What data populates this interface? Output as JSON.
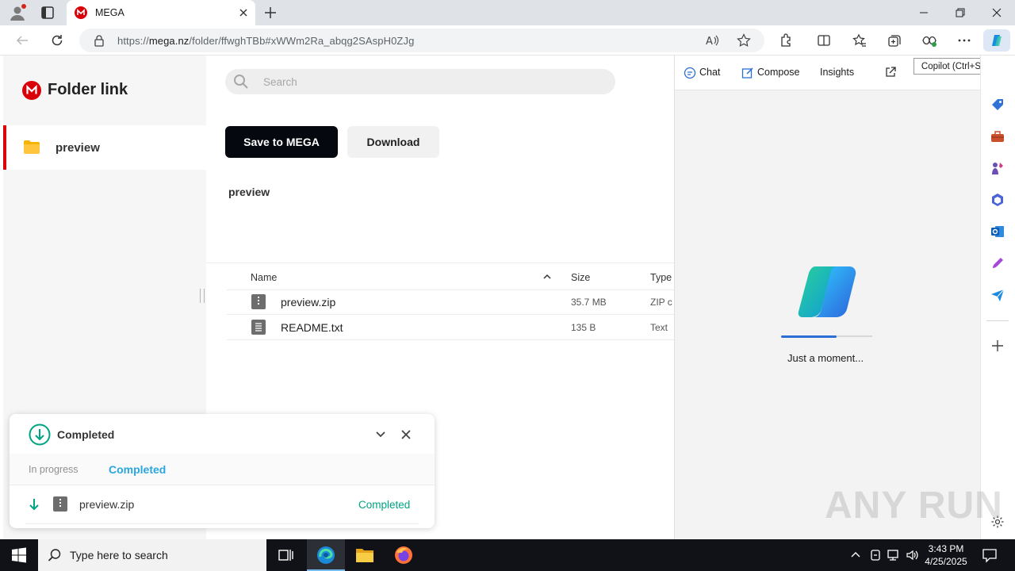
{
  "browser": {
    "tab_title": "MEGA",
    "url_prefix": "https://",
    "url_host": "mega.nz",
    "url_path": "/folder/ffwghTBb#xWWm2Ra_abqg2SAspH0ZJg"
  },
  "mega": {
    "brand": "Folder link",
    "sidebar_item": "preview",
    "search_placeholder": "Search",
    "save_button": "Save to MEGA",
    "download_button": "Download",
    "folder_title": "preview",
    "columns": {
      "name": "Name",
      "size": "Size",
      "type": "Type"
    },
    "files": [
      {
        "name": "preview.zip",
        "size": "35.7 MB",
        "type": "ZIP c"
      },
      {
        "name": "README.txt",
        "size": "135 B",
        "type": "Text"
      }
    ]
  },
  "transfers": {
    "title": "Completed",
    "tab_in_progress": "In progress",
    "tab_completed": "Completed",
    "item_name": "preview.zip",
    "item_status": "Completed"
  },
  "copilot": {
    "tabs": [
      "Chat",
      "Compose",
      "Insights"
    ],
    "loading_text": "Just a moment...",
    "tooltip": "Copilot (Ctrl+Shift+.)"
  },
  "taskbar": {
    "search_placeholder": "Type here to search",
    "time": "3:43 PM",
    "date": "4/25/2025"
  },
  "watermark": "ANY RUN",
  "colors": {
    "mega_red": "#d90007",
    "teal": "#00a382",
    "link_blue": "#2ba6de"
  }
}
